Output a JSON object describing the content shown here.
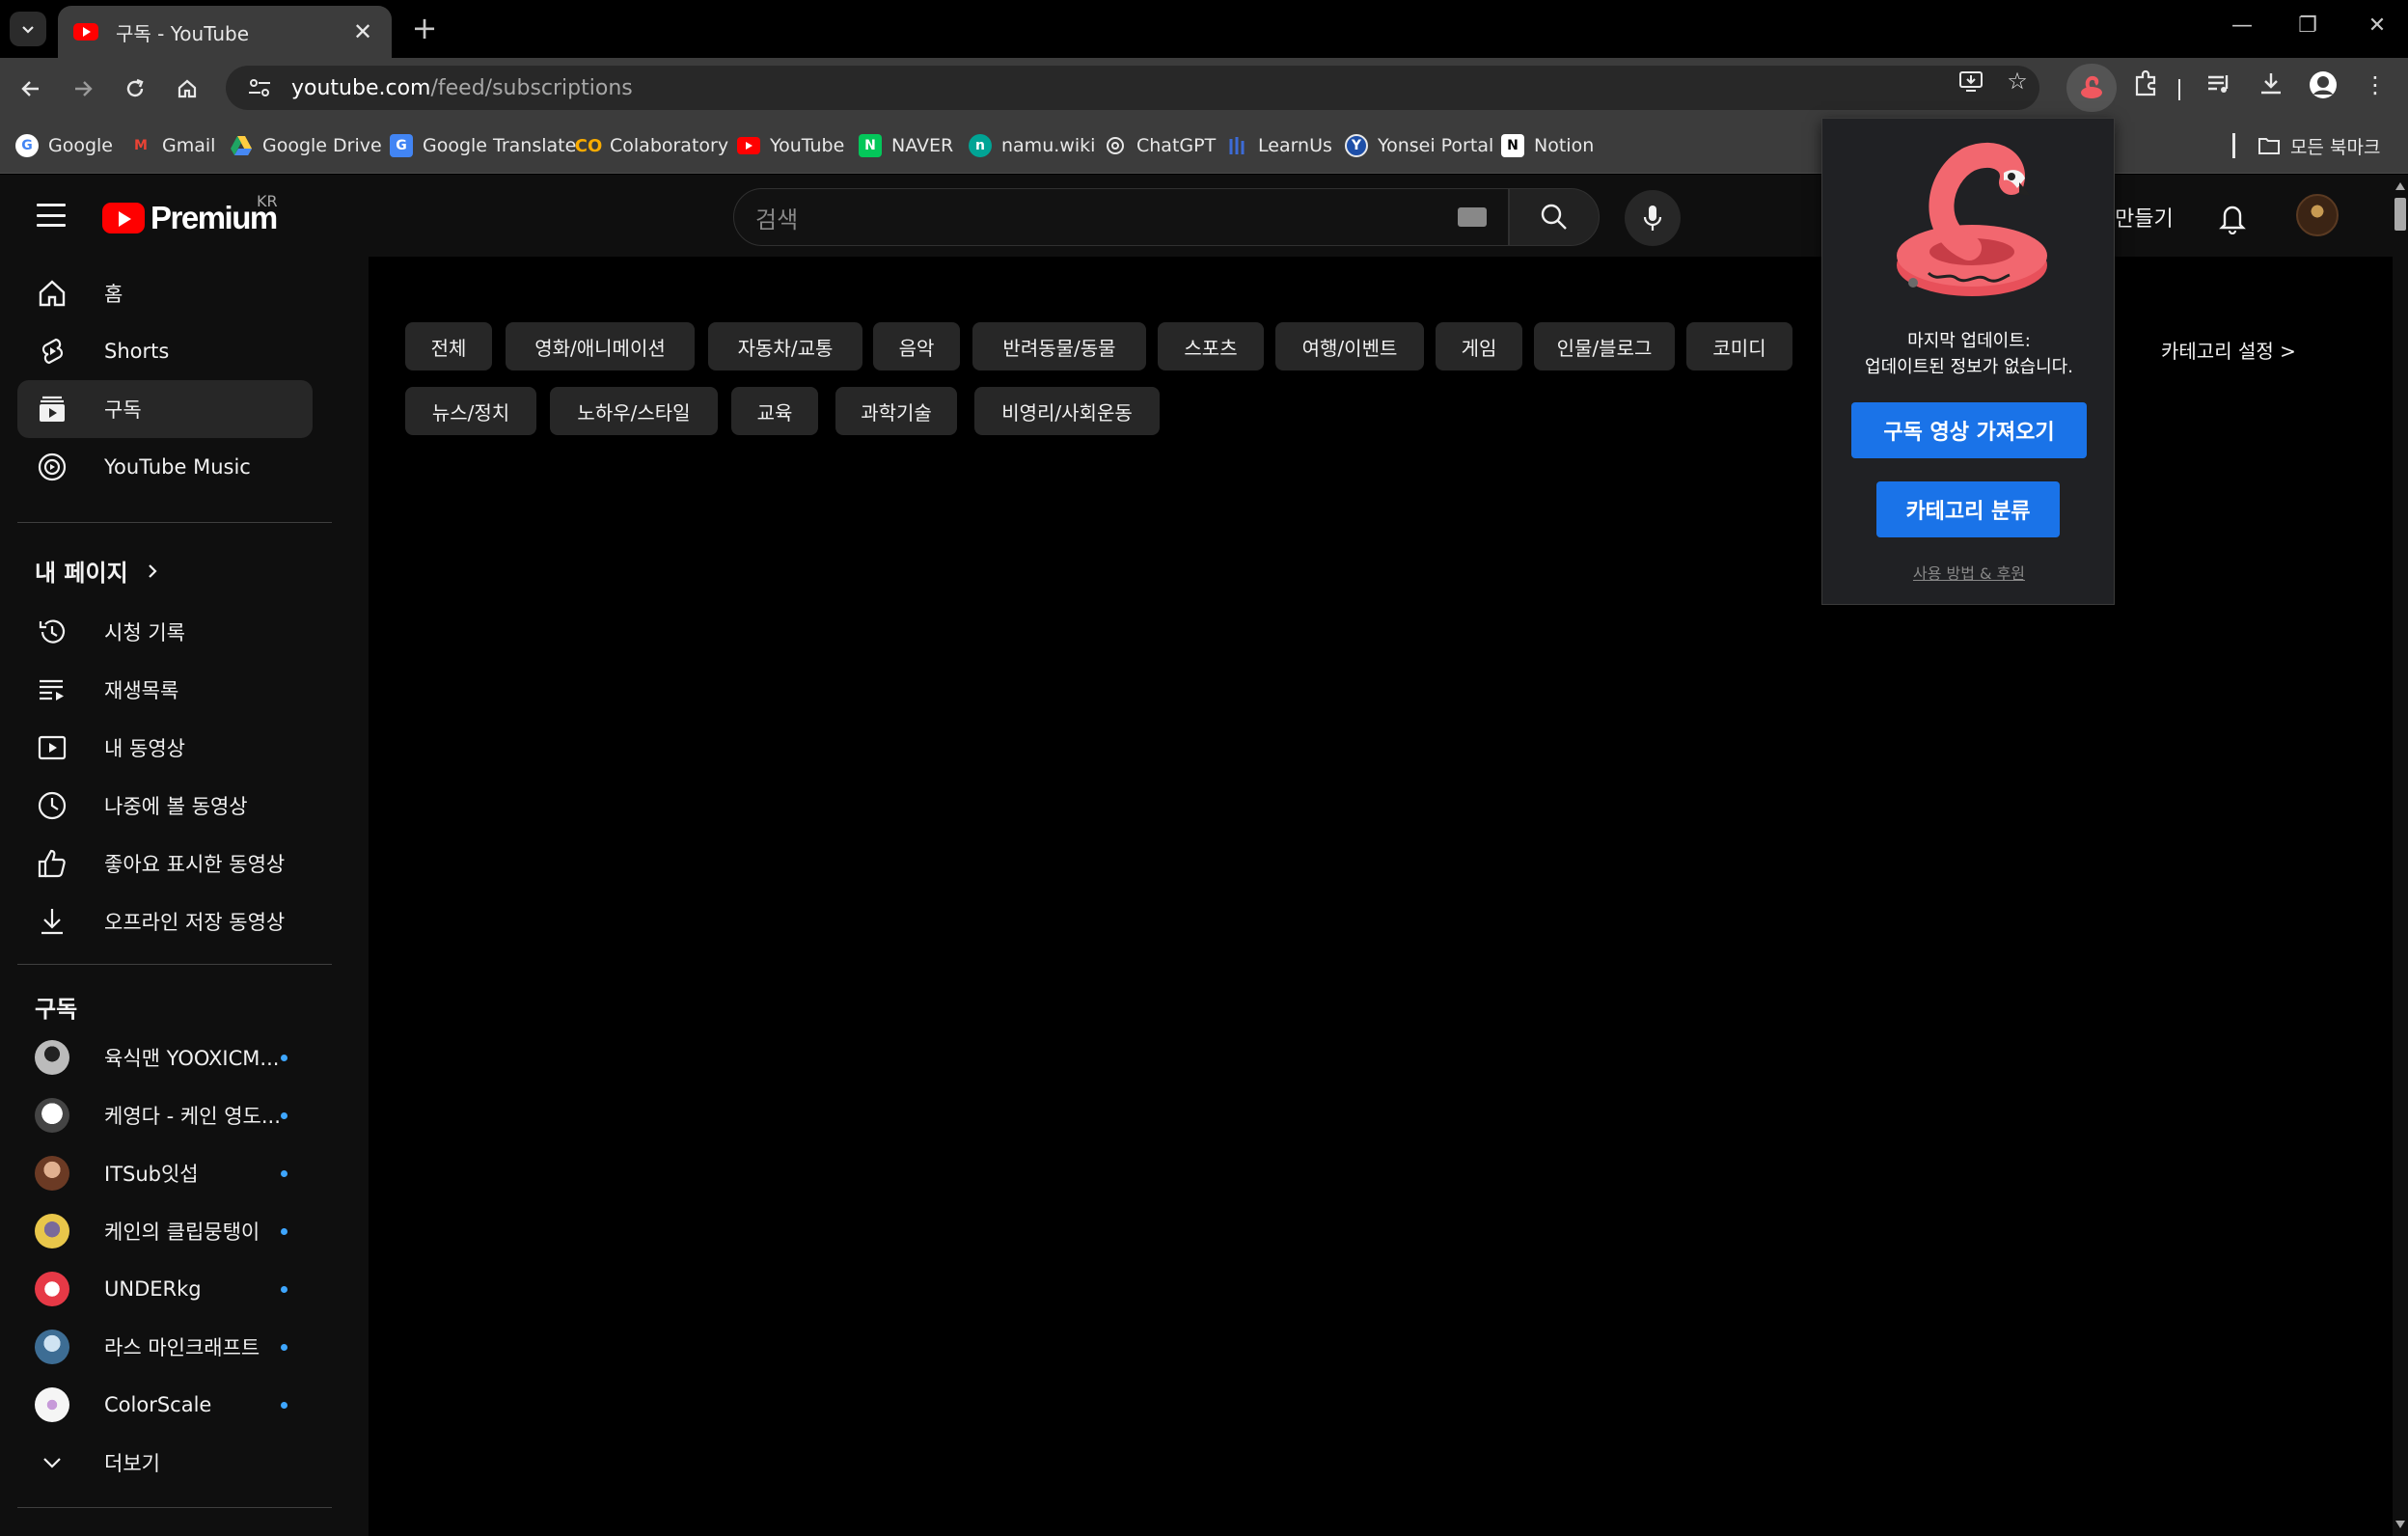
{
  "browser": {
    "tab_title": "구독 - YouTube",
    "new_tab": "+",
    "url_host": "youtube.com",
    "url_path": "/feed/subscriptions",
    "bookmarks": [
      {
        "label": "Google",
        "icon": "google-icon",
        "color": "#4285f4"
      },
      {
        "label": "Gmail",
        "icon": "gmail-icon",
        "color": "#ea4335"
      },
      {
        "label": "Google Drive",
        "icon": "google-drive-icon",
        "color": "#1fa463"
      },
      {
        "label": "Google Translate",
        "icon": "google-translate-icon",
        "color": "#4285f4"
      },
      {
        "label": "Colaboratory",
        "icon": "colab-icon",
        "color": "#f9ab00"
      },
      {
        "label": "YouTube",
        "icon": "youtube-icon",
        "color": "#ff0000"
      },
      {
        "label": "NAVER",
        "icon": "naver-icon",
        "color": "#03c75a"
      },
      {
        "label": "namu.wiki",
        "icon": "namuwiki-icon",
        "color": "#00a495"
      },
      {
        "label": "ChatGPT",
        "icon": "chatgpt-icon",
        "color": "#ffffff"
      },
      {
        "label": "LearnUs",
        "icon": "learnus-icon",
        "color": "#3d6bd6"
      },
      {
        "label": "Yonsei Portal",
        "icon": "yonsei-icon",
        "color": "#1e4fa8"
      },
      {
        "label": "Notion",
        "icon": "notion-icon",
        "color": "#ffffff"
      }
    ],
    "all_bookmarks": "모든 북마크"
  },
  "youtube": {
    "logo_text": "Premium",
    "region": "KR",
    "search_placeholder": "검색",
    "create_label": "만들기",
    "sidebar": {
      "main": [
        {
          "label": "홈",
          "icon": "home-icon"
        },
        {
          "label": "Shorts",
          "icon": "shorts-icon"
        },
        {
          "label": "구독",
          "icon": "subscriptions-icon",
          "active": true
        },
        {
          "label": "YouTube Music",
          "icon": "youtube-music-icon"
        }
      ],
      "my_page_heading": "내 페이지",
      "my_page": [
        {
          "label": "시청 기록",
          "icon": "history-icon"
        },
        {
          "label": "재생목록",
          "icon": "playlist-icon"
        },
        {
          "label": "내 동영상",
          "icon": "my-videos-icon"
        },
        {
          "label": "나중에 볼 동영상",
          "icon": "watch-later-icon"
        },
        {
          "label": "좋아요 표시한 동영상",
          "icon": "like-icon"
        },
        {
          "label": "오프라인 저장 동영상",
          "icon": "download-icon"
        }
      ],
      "subscriptions_heading": "구독",
      "subscriptions": [
        {
          "label": "육식맨 YOOXICM...",
          "avatar": "#8a8a8a"
        },
        {
          "label": "케영다 - 케인 영도...",
          "avatar": "#dddddd"
        },
        {
          "label": "ITSub잇섭",
          "avatar": "#a0522d"
        },
        {
          "label": "케인의 클립뭉탱이",
          "avatar": "#d9b44a"
        },
        {
          "label": "UNDERkg",
          "avatar": "#e63946"
        },
        {
          "label": "라스 마인크래프트",
          "avatar": "#5b8db8"
        },
        {
          "label": "ColorScale",
          "avatar": "#f5f5f5"
        }
      ],
      "more_label": "더보기"
    },
    "chips_row1": [
      "전체",
      "영화/애니메이션",
      "자동차/교통",
      "음악",
      "반려동물/동물",
      "스포츠",
      "여행/이벤트",
      "게임",
      "인물/블로그",
      "코미디"
    ],
    "chips_row2": [
      "뉴스/정치",
      "노하우/스타일",
      "교육",
      "과학기술",
      "비영리/사회운동"
    ],
    "category_settings": "카테고리 설정 >"
  },
  "extension_popup": {
    "last_update_title": "마지막 업데이트:",
    "last_update_text": "업데이트된 정보가 없습니다.",
    "fetch_button": "구독 영상 가져오기",
    "classify_button": "카테고리 분류",
    "help_link": "사용 방법 & 후원"
  }
}
